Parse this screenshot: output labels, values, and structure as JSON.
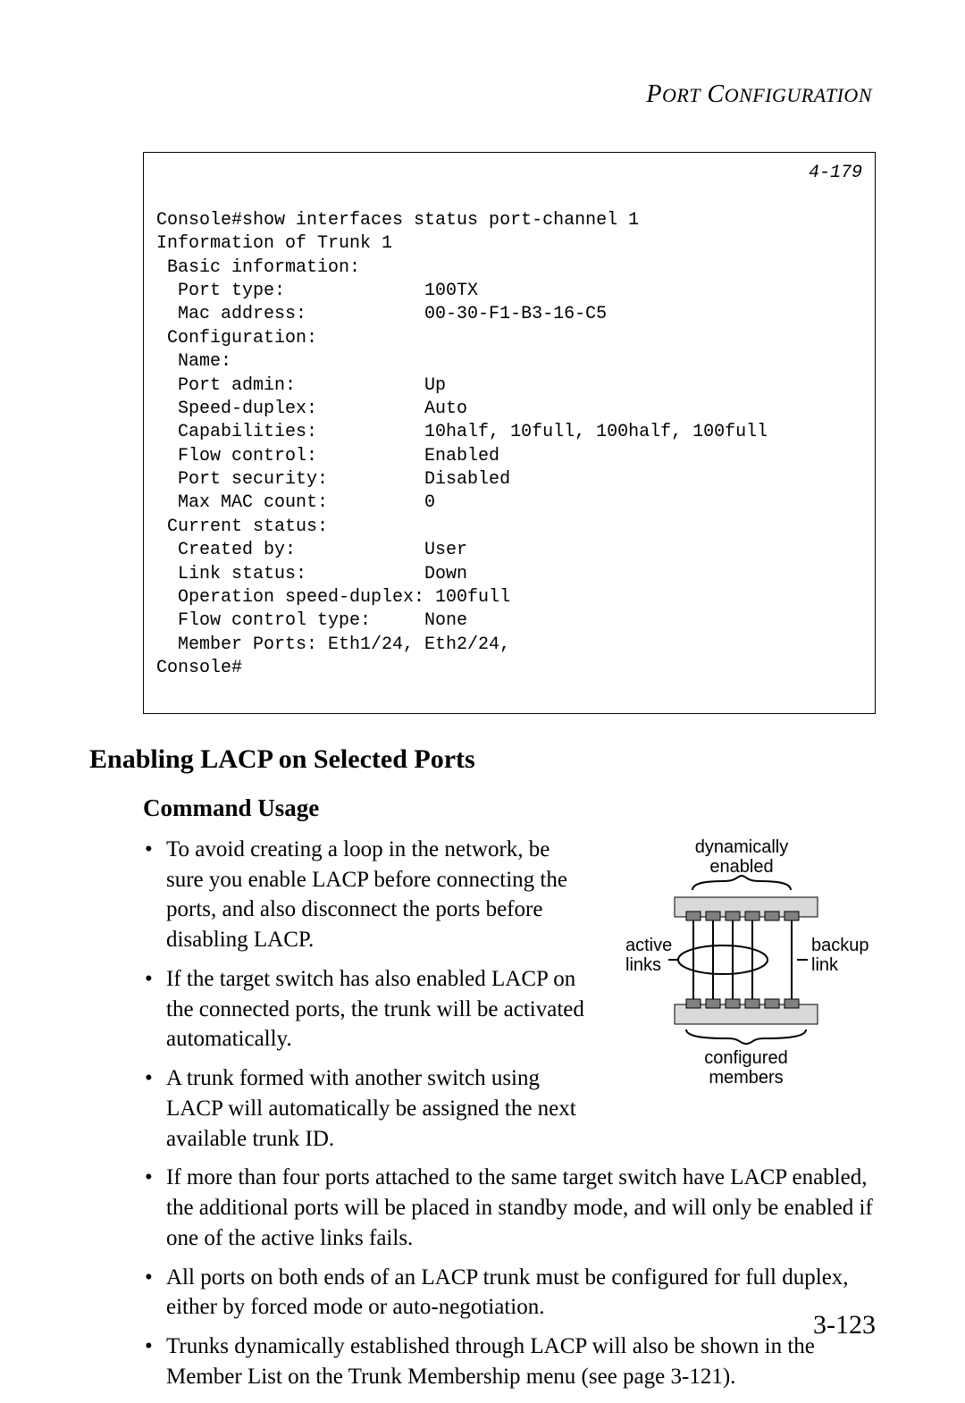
{
  "running_head": "Port Configuration",
  "page_number": "3-123",
  "console": {
    "ref": "4-179",
    "lines": [
      "Console#show interfaces status port-channel 1",
      "Information of Trunk 1",
      " Basic information:",
      "  Port type:             100TX",
      "  Mac address:           00-30-F1-B3-16-C5",
      " Configuration:",
      "  Name:",
      "  Port admin:            Up",
      "  Speed-duplex:          Auto",
      "  Capabilities:          10half, 10full, 100half, 100full",
      "  Flow control:          Enabled",
      "  Port security:         Disabled",
      "  Max MAC count:         0",
      " Current status:",
      "  Created by:            User",
      "  Link status:           Down",
      "  Operation speed-duplex: 100full",
      "  Flow control type:     None",
      "  Member Ports: Eth1/24, Eth2/24,",
      "Console#"
    ]
  },
  "section_title": "Enabling LACP on Selected Ports",
  "subsection_title": "Command Usage",
  "bullets_left": [
    "To avoid creating a loop in the network, be sure you enable LACP before connecting the ports, and also disconnect the ports before disabling LACP.",
    "If the target switch has also enabled LACP on the connected ports, the trunk will be activated automatically.",
    "A trunk formed with another switch using LACP will automatically be assigned the next available trunk ID."
  ],
  "bullets_full": [
    "If more than four ports attached to the same target switch have LACP enabled, the additional ports will be placed in standby mode, and will only be enabled if one of the active links fails.",
    "All ports on both ends of an LACP trunk must be configured for full duplex, either by forced mode or auto-negotiation.",
    "Trunks dynamically established through LACP will also be shown in the Member List on the Trunk Membership menu (see page 3-121)."
  ],
  "diagram": {
    "top_label_1": "dynamically",
    "top_label_2": "enabled",
    "left_label_1": "active",
    "left_label_2": "links",
    "right_label_1": "backup",
    "right_label_2": "link",
    "bottom_label_1": "configured",
    "bottom_label_2": "members"
  }
}
